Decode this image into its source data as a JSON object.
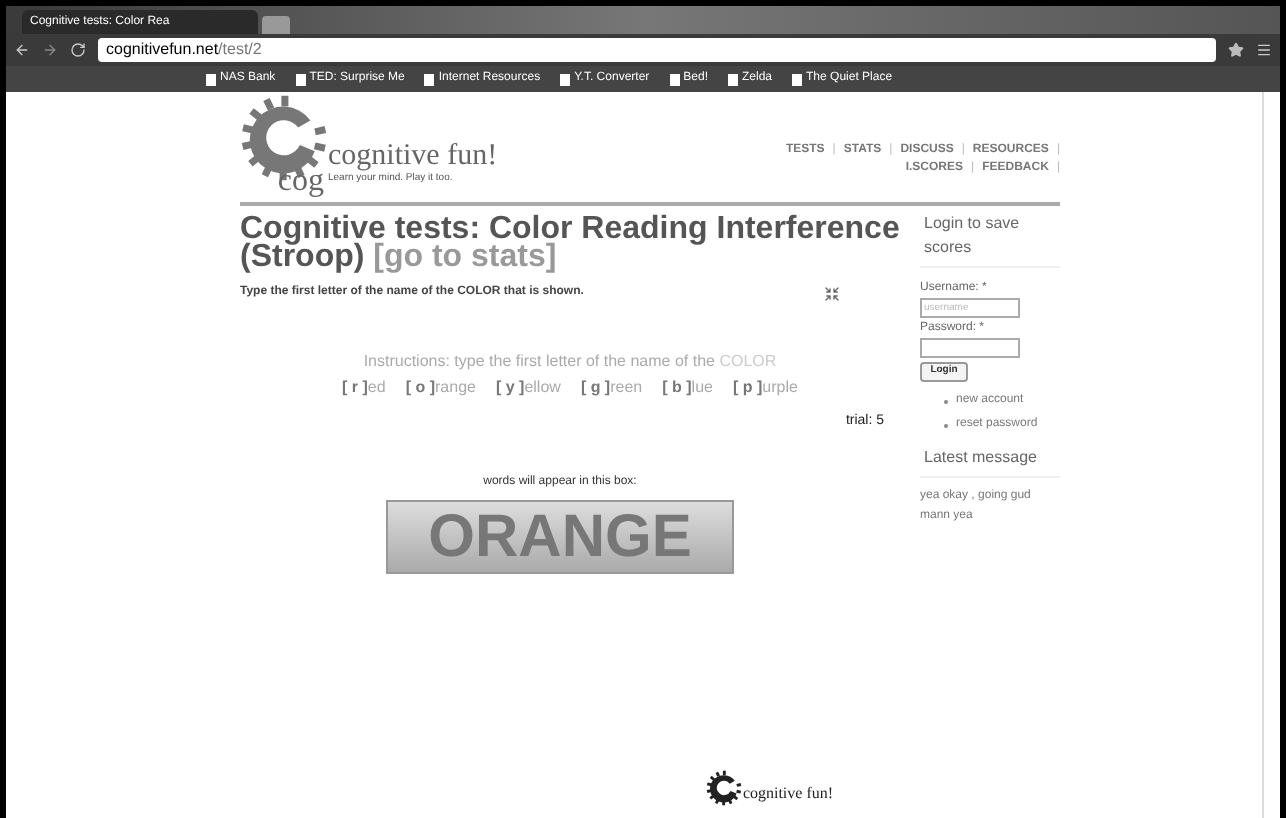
{
  "browser": {
    "tab_title": "Cognitive tests: Color Rea",
    "url_domain": "cognitivefun.net",
    "url_path": "/test/2",
    "bookmarks": [
      {
        "label": "NAS Bank"
      },
      {
        "label": "TED: Surprise Me"
      },
      {
        "label": "Internet Resources"
      },
      {
        "label": "Y.T. Converter"
      },
      {
        "label": "Bed!"
      },
      {
        "label": "Zelda"
      },
      {
        "label": "The Quiet Place"
      }
    ]
  },
  "header": {
    "site_name": "cognitive fun!",
    "logo_text": "cog",
    "tagline": "Learn your mind. Play it too.",
    "separator": "|",
    "nav": [
      {
        "label": "TESTS"
      },
      {
        "label": "STATS"
      },
      {
        "label": "DISCUSS"
      },
      {
        "label": "RESOURCES"
      },
      {
        "label": "I.SCORES"
      },
      {
        "label": "FEEDBACK"
      }
    ]
  },
  "main": {
    "title": "Cognitive tests: Color Reading Interference (Stroop)",
    "title_link": "[go to stats]",
    "prompt": "Type the first letter of the name of the COLOR that is shown.",
    "instructions": "Instructions: type the first letter of the name of the",
    "instructions_highlight": "COLOR",
    "options": [
      {
        "key": "[ r ]",
        "rest": "ed"
      },
      {
        "key": "[ o ]",
        "rest": "range"
      },
      {
        "key": "[ y ]",
        "rest": "ellow"
      },
      {
        "key": "[ g ]",
        "rest": "reen"
      },
      {
        "key": "[ b ]",
        "rest": "lue"
      },
      {
        "key": "[ p ]",
        "rest": "urple"
      }
    ],
    "trial": "trial: 5",
    "box_label": "words will appear in this box:",
    "word": "ORANGE"
  },
  "sidebar": {
    "login_heading": "Login to save scores",
    "username_label": "Username: *",
    "username_placeholder": "username",
    "password_label": "Password: *",
    "login_button": "Login",
    "links": [
      "new account",
      "reset password"
    ],
    "latest_heading": "Latest message",
    "message": "yea okay , going gud mann yea"
  },
  "footer": {
    "logo_text": "cognitive fun!"
  }
}
